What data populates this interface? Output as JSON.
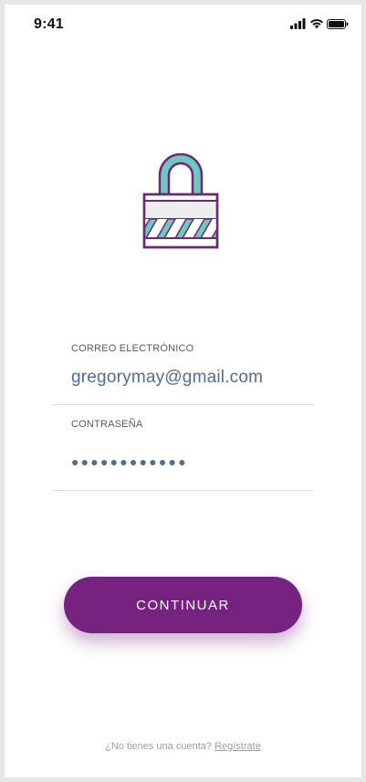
{
  "status_bar": {
    "time": "9:41",
    "icons": [
      "signal-icon",
      "wifi-icon",
      "battery-icon"
    ]
  },
  "illustration": {
    "name": "lock-icon",
    "colors": {
      "outline": "#6b2a73",
      "shackle_fill": "#6fc8bf",
      "body_fill": "#eeeeee",
      "stripe_teal": "#6fc8bf"
    }
  },
  "form": {
    "email": {
      "label": "CORREO ELECTRÓNICO",
      "value": "gregorymay@gmail.com"
    },
    "password": {
      "label": "CONTRASEÑA",
      "masked_value": "●●●●●●●●●●●●"
    }
  },
  "actions": {
    "continue_label": "CONTINUAR"
  },
  "footer": {
    "prompt": "¿No tienes una cuenta?",
    "link": "Regístrate"
  },
  "colors": {
    "accent": "#762281",
    "input_text": "#4d6e8f",
    "muted_text": "#9a9ea6"
  }
}
